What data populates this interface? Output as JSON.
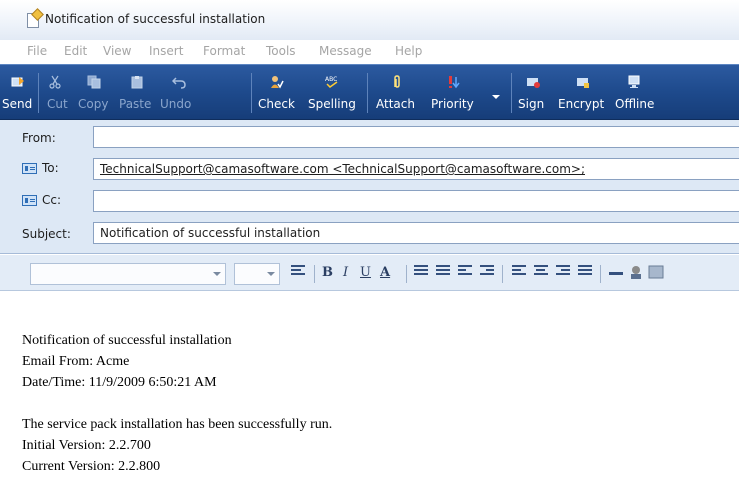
{
  "window": {
    "title": "Notification of successful installation"
  },
  "menu": [
    "File",
    "Edit",
    "View",
    "Insert",
    "Format",
    "Tools",
    "Message",
    "Help"
  ],
  "toolbar": {
    "send": "Send",
    "cut": "Cut",
    "copy": "Copy",
    "paste": "Paste",
    "undo": "Undo",
    "check": "Check",
    "spelling": "Spelling",
    "attach": "Attach",
    "priority": "Priority",
    "sign": "Sign",
    "encrypt": "Encrypt",
    "offline": "Offline"
  },
  "header": {
    "from_label": "From:",
    "from_value": "",
    "to_label": "To:",
    "to_value": "TechnicalSupport@camasoftware.com <TechnicalSupport@camasoftware.com>;",
    "cc_label": "Cc:",
    "cc_value": "",
    "subject_label": "Subject:",
    "subject_value": "Notification of successful installation"
  },
  "format_bar": {
    "font_name": "",
    "font_size": "",
    "bold": "B",
    "italic": "I",
    "underline": "U",
    "font_color": "A"
  },
  "body": {
    "line1": "Notification of successful installation",
    "line2": "Email From: Acme",
    "line3": "Date/Time: 11/9/2009  6:50:21 AM",
    "line4": "The service pack installation has been successfully run.",
    "line5": "Initial Version: 2.2.700",
    "line6": "Current Version: 2.2.800"
  },
  "colors": {
    "toolbar_bg": "#1e4a8c",
    "header_bg": "#dde8f5",
    "disabled_text": "#a5a5a5"
  }
}
